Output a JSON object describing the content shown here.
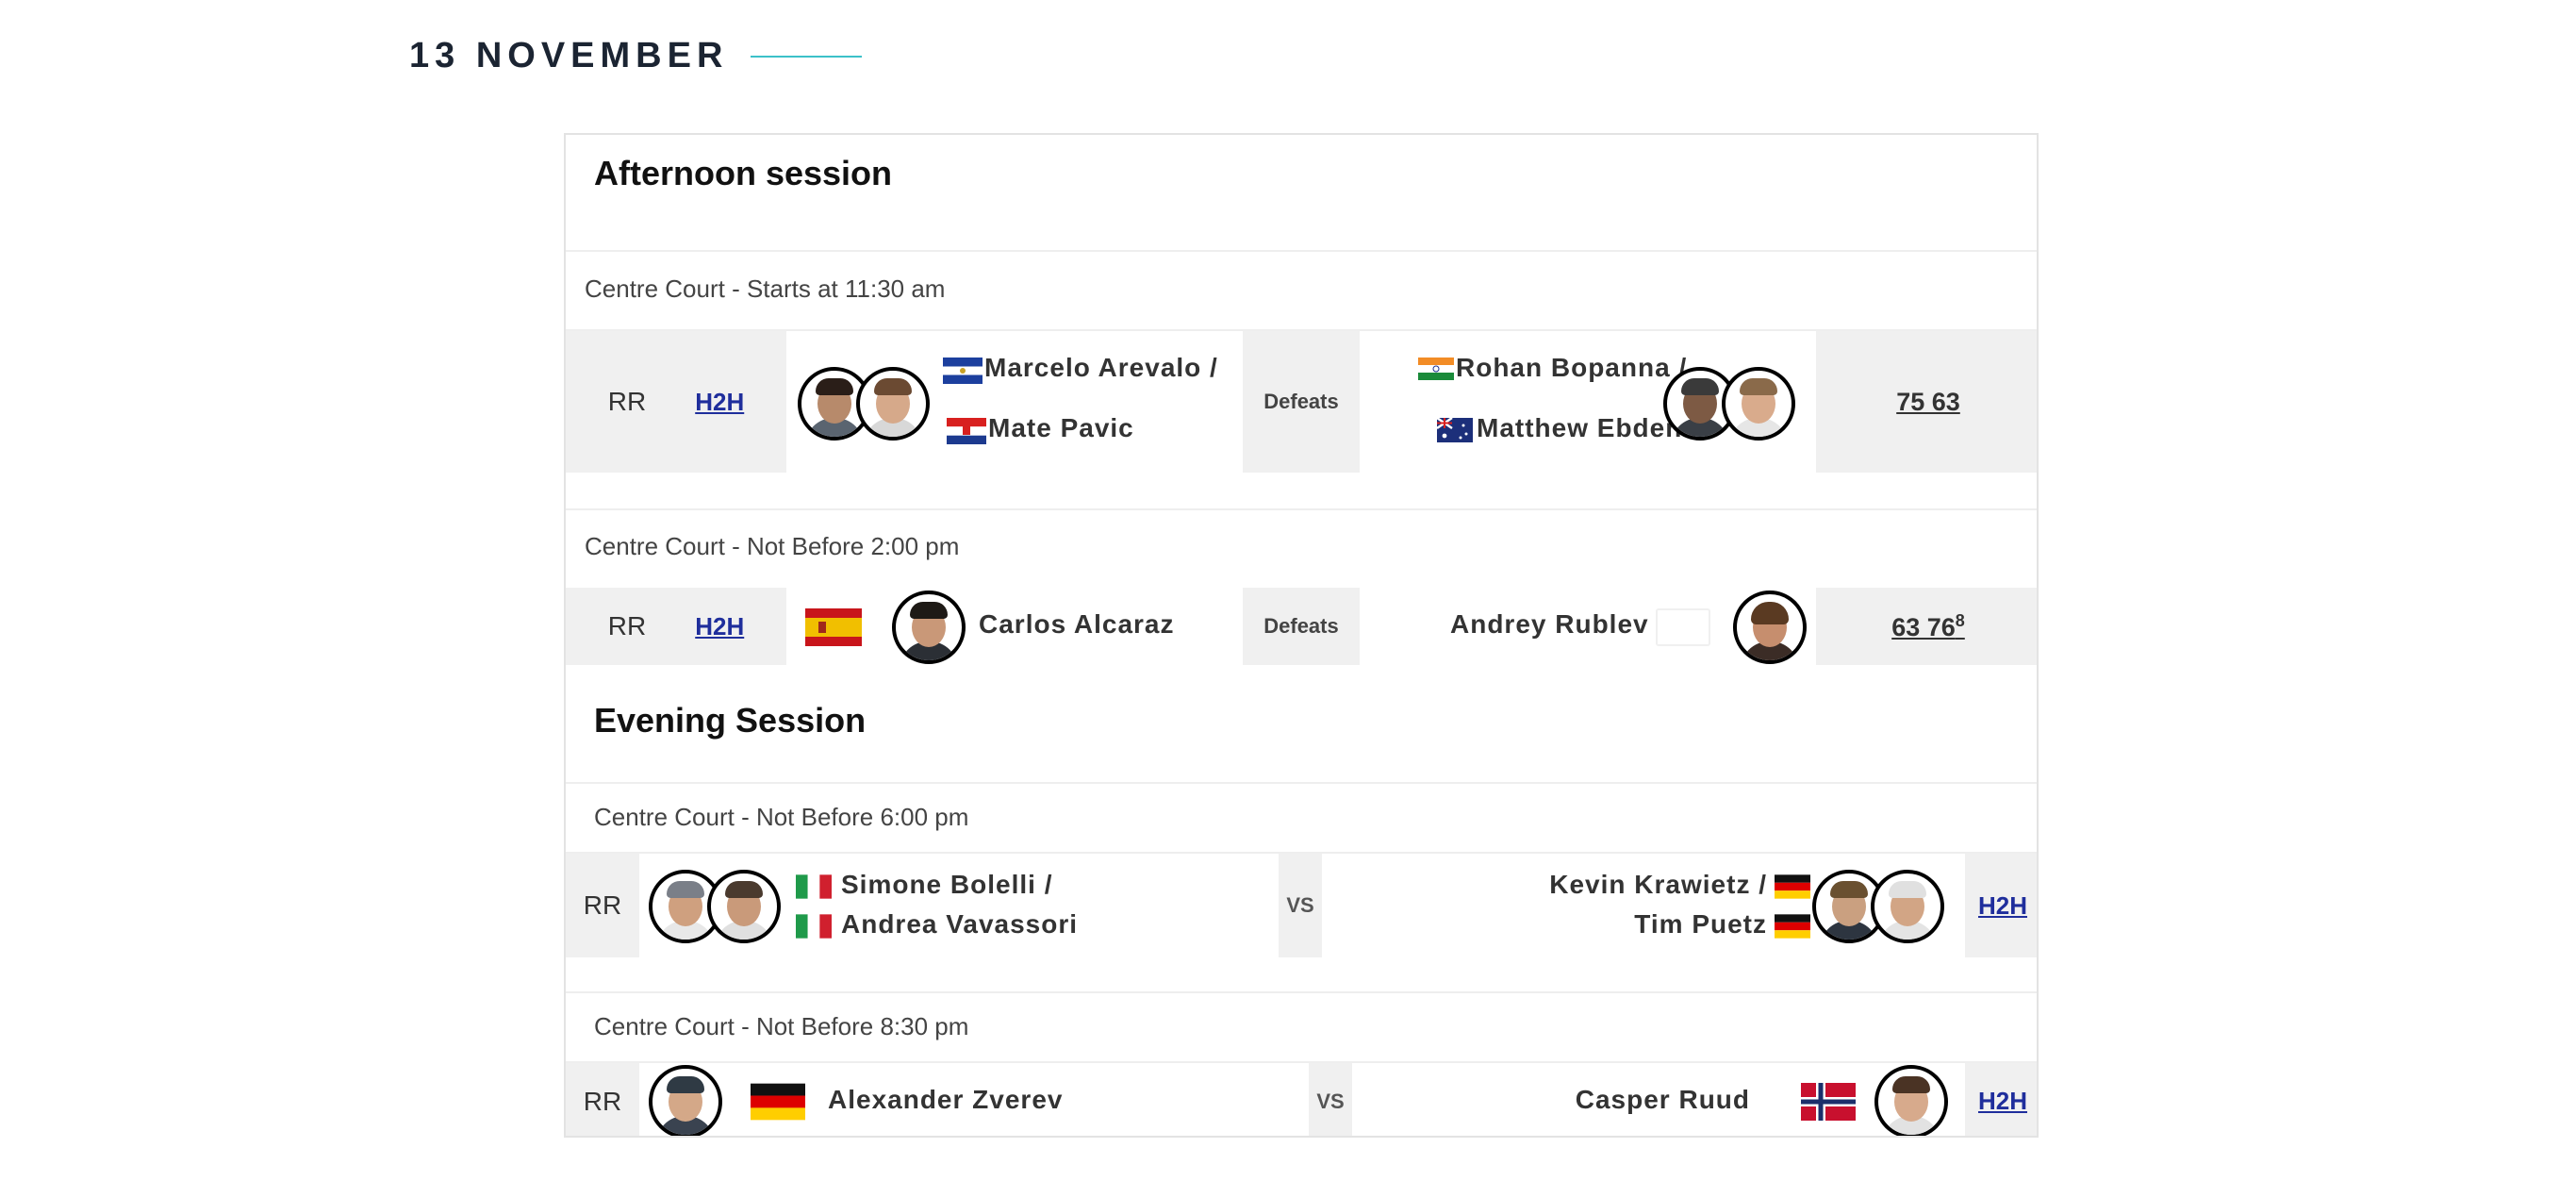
{
  "date_header": {
    "title": "13 NOVEMBER"
  },
  "sessions": [
    {
      "title": "Afternoon session",
      "matches": [
        {
          "court": "Centre Court - Starts at 11:30 am",
          "round": "RR",
          "h2h": "H2H",
          "left": {
            "players": [
              "Marcelo Arevalo /",
              "Mate Pavic"
            ],
            "flags": [
              "el-salvador-flag",
              "croatia-flag"
            ]
          },
          "result": "Defeats",
          "right": {
            "players": [
              "Rohan Bopanna /",
              "Matthew Ebden"
            ],
            "flags": [
              "india-flag",
              "australia-flag"
            ]
          },
          "score": "75 63"
        },
        {
          "court": "Centre Court - Not Before 2:00 pm",
          "round": "RR",
          "h2h": "H2H",
          "left": {
            "players": [
              "Carlos Alcaraz"
            ],
            "flags": [
              "spain-flag"
            ]
          },
          "result": "Defeats",
          "right": {
            "players": [
              "Andrey Rublev"
            ],
            "flags": [
              "blank-flag"
            ]
          },
          "score": {
            "main": "63 76",
            "sup": "8"
          }
        }
      ]
    },
    {
      "title": "Evening Session",
      "matches": [
        {
          "court": "Centre Court - Not Before 6:00 pm",
          "round": "RR",
          "left": {
            "players": [
              "Simone Bolelli /",
              "Andrea Vavassori"
            ],
            "flags": [
              "italy-flag",
              "italy-flag"
            ]
          },
          "vs": "VS",
          "right": {
            "players": [
              "Kevin Krawietz /",
              "Tim Puetz"
            ],
            "flags": [
              "germany-flag",
              "germany-flag"
            ]
          },
          "h2h": "H2H"
        },
        {
          "court": "Centre Court - Not Before 8:30 pm",
          "round": "RR",
          "left": {
            "players": [
              "Alexander Zverev"
            ],
            "flags": [
              "germany-flag"
            ]
          },
          "vs": "VS",
          "right": {
            "players": [
              "Casper Ruud"
            ],
            "flags": [
              "norway-flag"
            ]
          },
          "h2h": "H2H"
        }
      ]
    }
  ],
  "colors": {
    "accent_rule": "#3cc1c9",
    "link": "#1f2e9c",
    "row_grey": "#f0f0f0"
  }
}
